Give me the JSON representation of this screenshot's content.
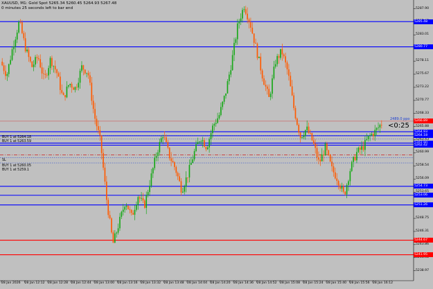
{
  "header": {
    "symbol_line": "XAUUSD, M1: Gold Spot 5265.34 5260.45 5264.93 5267.48",
    "timer_line": "0 minutes 25 seconds left to bar end"
  },
  "countdown": "<0:25",
  "points_label": "2489.0 ppo",
  "trade_labels": [
    {
      "text": "BUY 1 at 5264.18",
      "color": "#1f3fd0"
    },
    {
      "text": "BUY 1 at 5263.59",
      "color": "#1f3fd0"
    },
    {
      "text": "SL",
      "color": "#d00000"
    },
    {
      "text": "BUY 1 at 5260.05",
      "color": "#1f3fd0"
    },
    {
      "text": "BUY 1 at 5259.1",
      "color": "#1f3fd0"
    }
  ],
  "price_labels": [
    {
      "text": "5285.48",
      "color": "#0000ff"
    },
    {
      "text": "5280.77",
      "color": "#0000ff"
    },
    {
      "text": "5266.89",
      "color": "#ff0000"
    },
    {
      "text": "5264.93",
      "color": "#0000ff"
    },
    {
      "text": "5264.18",
      "color": "#0000ff"
    },
    {
      "text": "5262.80",
      "color": "#0000ff"
    },
    {
      "text": "5262.42",
      "color": "#0000ff"
    },
    {
      "text": "5254.73",
      "color": "#0000ff"
    },
    {
      "text": "5253.06",
      "color": "#0000ff"
    },
    {
      "text": "5251.26",
      "color": "#0000ff"
    },
    {
      "text": "5244.67",
      "color": "#ff0000"
    },
    {
      "text": "5241.95",
      "color": "#ff0000"
    }
  ],
  "price_scale": [
    "5287.90",
    "5285.45",
    "5283.01",
    "5278.11",
    "5275.67",
    "5273.22",
    "5270.77",
    "5268.33",
    "5265.88",
    "5263.43",
    "5260.99",
    "5258.54",
    "5256.09",
    "5253.65",
    "5251.20",
    "5248.75",
    "5246.31",
    "5243.86",
    "5241.41",
    "5238.97"
  ],
  "time_scale": [
    "28 Jan 2026",
    "28 Jan 12:12",
    "28 Jan 12:28",
    "28 Jan 12:44",
    "28 Jan 13:00",
    "28 Jan 13:16",
    "28 Jan 13:32",
    "28 Jan 13:48",
    "28 Jan 14:04",
    "28 Jan 14:20",
    "28 Jan 14:36",
    "28 Jan 14:52",
    "28 Jan 15:08",
    "28 Jan 15:24",
    "28 Jan 15:40",
    "28 Jan 15:56",
    "28 Jan 16:12"
  ],
  "colors": {
    "background": "#c0c0c0",
    "bull": "#16a816",
    "bear": "#ff5a00",
    "level_line": "#0000ff",
    "stop_line": "#ff0000",
    "current_line": "#ff0000"
  },
  "chart_data": {
    "type": "candlestick",
    "symbol": "XAUUSD",
    "timeframe": "M1",
    "y_range": [
      5237.5,
      5289.0
    ],
    "path_prices": [
      5278.0,
      5275.5,
      5281.0,
      5285.5,
      5280.5,
      5277.0,
      5279.0,
      5274.5,
      5278.5,
      5276.0,
      5271.0,
      5274.0,
      5273.0,
      5277.0,
      5276.0,
      5268.0,
      5263.0,
      5252.0,
      5244.0,
      5248.0,
      5252.0,
      5249.0,
      5253.0,
      5251.0,
      5256.0,
      5261.0,
      5264.5,
      5260.5,
      5258.0,
      5254.0,
      5257.0,
      5261.0,
      5264.0,
      5262.0,
      5266.0,
      5268.0,
      5272.0,
      5278.0,
      5285.0,
      5288.5,
      5285.0,
      5280.0,
      5275.0,
      5271.0,
      5278.0,
      5280.0,
      5276.0,
      5269.0,
      5264.0,
      5265.5,
      5263.0,
      5259.0,
      5262.0,
      5258.0,
      5256.0,
      5253.0,
      5258.0,
      5261.0,
      5262.0,
      5264.0,
      5265.0,
      5266.5
    ]
  }
}
